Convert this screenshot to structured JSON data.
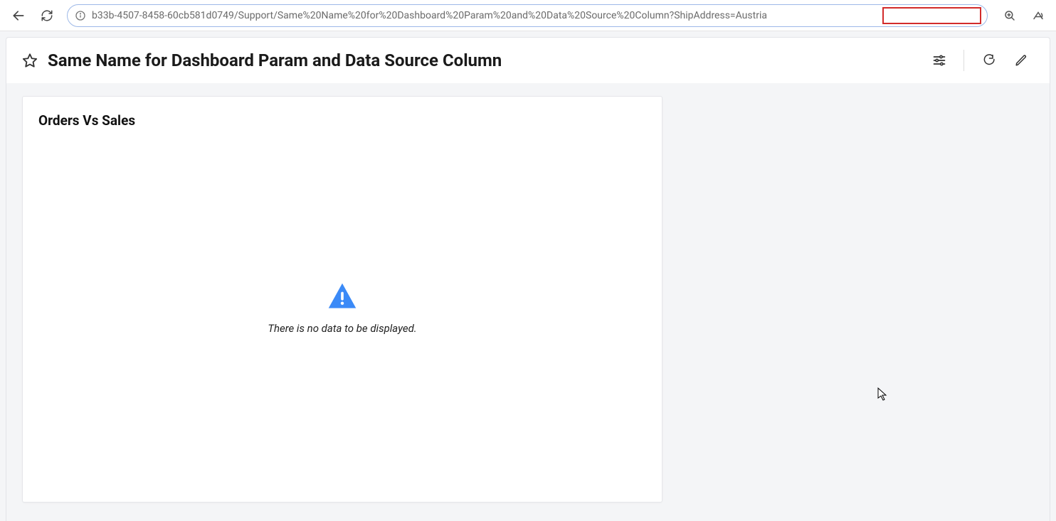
{
  "browser": {
    "url": "b33b-4507-8458-60cb581d0749/Support/Same%20Name%20for%20Dashboard%20Param%20and%20Data%20Source%20Column?ShipAddress=Austria",
    "highlighted_param": "ShipAddress=Austria"
  },
  "header": {
    "title": "Same Name for Dashboard Param and Data Source Column"
  },
  "widget": {
    "title": "Orders Vs Sales",
    "empty_message": "There is no data to be displayed."
  }
}
